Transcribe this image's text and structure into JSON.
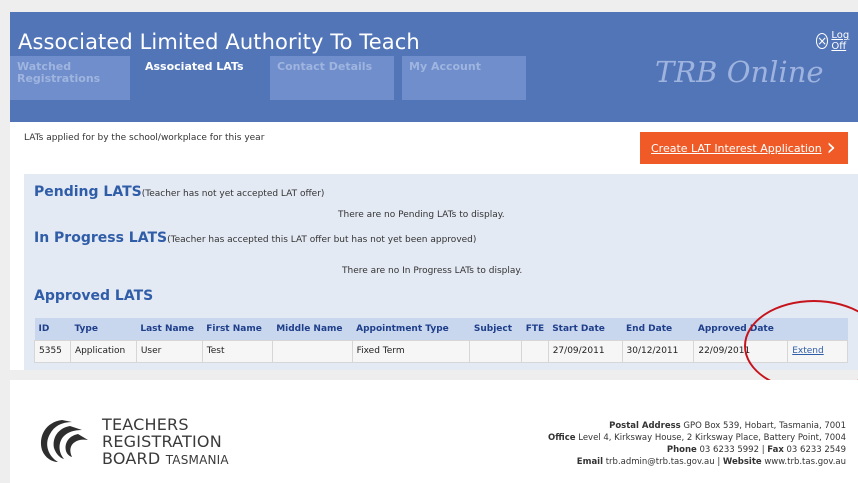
{
  "app": {
    "title": "Associated Limited Authority To Teach",
    "brand": "TRB Online",
    "logoff_label": "Log Off"
  },
  "tabs": [
    {
      "label_line1": "Watched",
      "label_line2": "Registrations",
      "active": false
    },
    {
      "label_line1": "Associated LATs",
      "label_line2": "",
      "active": true
    },
    {
      "label_line1": "Contact Details",
      "label_line2": "",
      "active": false
    },
    {
      "label_line1": "My Account",
      "label_line2": "",
      "active": false
    }
  ],
  "content": {
    "intro": "LATs applied for by the school/workplace for this year",
    "create_button": "Create LAT Interest Application"
  },
  "pending": {
    "title": "Pending LATS",
    "subtitle": "(Teacher has not yet accepted LAT offer)",
    "empty": "There are no Pending LATs to display."
  },
  "in_progress": {
    "title": "In Progress LATS",
    "subtitle": "(Teacher has accepted this LAT offer but has not yet been approved)",
    "empty": "There are no In Progress LATs to display."
  },
  "approved": {
    "title": "Approved LATS",
    "columns": [
      "ID",
      "Type",
      "Last Name",
      "First Name",
      "Middle Name",
      "Appointment Type",
      "Subject",
      "FTE",
      "Start Date",
      "End Date",
      "Approved Date",
      ""
    ],
    "rows": [
      {
        "id": "5355",
        "type": "Application",
        "last_name": "User",
        "first_name": "Test",
        "middle_name": "",
        "appointment_type": "Fixed Term",
        "subject": "",
        "fte": "",
        "start_date": "27/09/2011",
        "end_date": "30/12/2011",
        "approved_date": "22/09/2011",
        "action": "Extend"
      }
    ]
  },
  "footer": {
    "org_line1": "TEACHERS",
    "org_line2": "REGISTRATION",
    "org_line3a": "BOARD",
    "org_line3b": "TASMANIA",
    "postal_label": "Postal Address",
    "postal_value": "GPO Box 539, Hobart, Tasmania, 7001",
    "office_label": "Office",
    "office_value": "Level 4, Kirksway House, 2 Kirksway Place, Battery Point, 7004",
    "phone_label": "Phone",
    "phone_value": "03 6233 5992",
    "fax_label": "Fax",
    "fax_value": "03 6233 2549",
    "email_label": "Email",
    "email_value": "trb.admin@trb.tas.gov.au",
    "website_label": "Website",
    "website_value": "www.trb.tas.gov.au"
  },
  "colors": {
    "header": "#5275b8",
    "tab_inactive": "#6f8ecb",
    "accent_orange": "#ef5a26",
    "section_title": "#2f5da8",
    "annotation_circle": "#c6141c"
  }
}
